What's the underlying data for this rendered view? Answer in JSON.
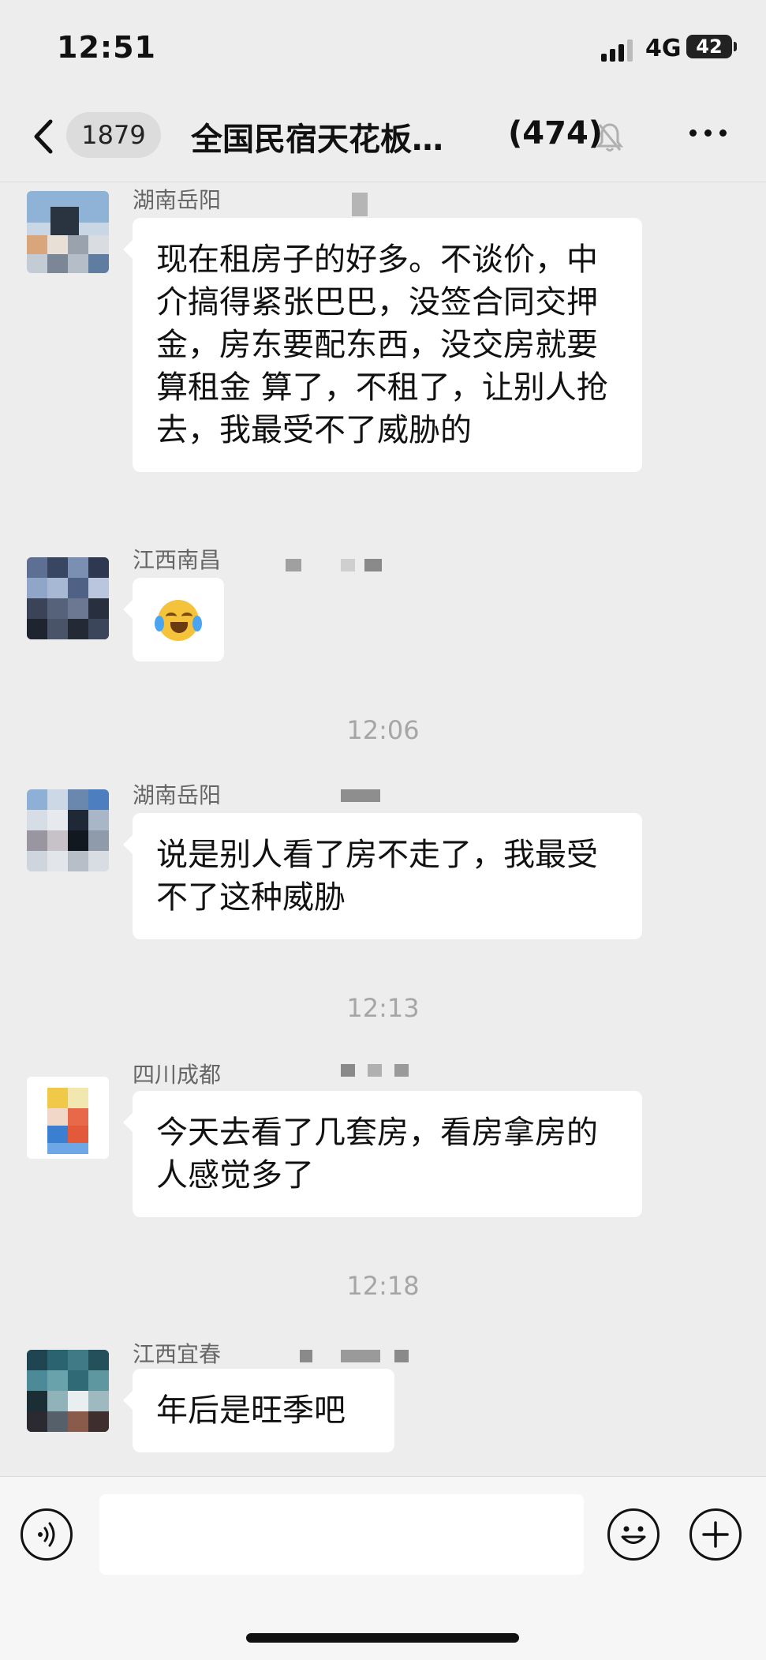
{
  "status_bar": {
    "time": "12:51",
    "network": "4G",
    "battery": "42"
  },
  "nav": {
    "unread_count": "1879",
    "title": "全国民宿天花板…",
    "member_count": "(474)"
  },
  "messages": [
    {
      "sender": "湖南岳阳",
      "text": "现在租房子的好多。不谈价，中介搞得紧张巴巴，没签合同交押金，房东要配东西，没交房就要算租金 算了，不租了，让别人抢去，我最受不了威胁的"
    },
    {
      "sender": "江西南昌",
      "emoji": "crying-laughing-emoji"
    },
    {
      "timestamp": "12:06"
    },
    {
      "sender": "湖南岳阳",
      "text": "说是别人看了房不走了，我最受不了这种威胁"
    },
    {
      "timestamp": "12:13"
    },
    {
      "sender": "四川成都",
      "text": "今天去看了几套房，看房拿房的人感觉多了"
    },
    {
      "timestamp": "12:18"
    },
    {
      "sender": "江西宜春",
      "text": "年后是旺季吧"
    }
  ],
  "icons": {
    "back": "chevron-left-icon",
    "mute": "bell-mute-icon",
    "more": "more-dots-icon",
    "voice": "voice-icon",
    "emoji": "smiley-icon",
    "plus": "plus-icon"
  }
}
